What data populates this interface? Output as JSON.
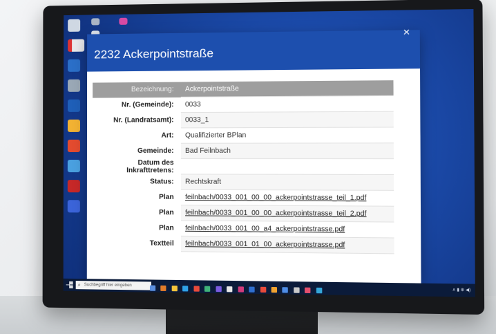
{
  "dialog": {
    "title": "2232 Ackerpointstraße",
    "close_label": "×"
  },
  "table": {
    "rows": [
      {
        "label": "Bezeichnung:",
        "value": "Ackerpointstraße"
      },
      {
        "label": "Nr. (Gemeinde):",
        "value": "0033"
      },
      {
        "label": "Nr. (Landratsamt):",
        "value": "0033_1"
      },
      {
        "label": "Art:",
        "value": "Qualifizierter BPlan"
      },
      {
        "label": "Gemeinde:",
        "value": "Bad Feilnbach"
      },
      {
        "label": "Datum des Inkrafttretens:",
        "value": ""
      },
      {
        "label": "Status:",
        "value": "Rechtskraft"
      },
      {
        "label": "Plan",
        "value": "feilnbach/0033_001_00_00_ackerpointstrasse_teil_1.pdf"
      },
      {
        "label": "Plan",
        "value": "feilnbach/0033_001_00_00_ackerpointstrasse_teil_2.pdf"
      },
      {
        "label": "Plan",
        "value": "feilnbach/0033_001_00_a4_ackerpointstrasse.pdf"
      },
      {
        "label": "Textteil",
        "value": "feilnbach/0033_001_01_00_ackerpointstrasse.pdf"
      }
    ]
  },
  "taskbar": {
    "search_placeholder": "Suchbegriff hier eingeben",
    "search_icon": "search-icon",
    "tray_text": "∧ ▮ ⊕ ◀)"
  },
  "colors": {
    "header_blue": "#1d4fae",
    "table_head_gray": "#9e9e9e",
    "desktop_blue": "#1b4aa9"
  }
}
